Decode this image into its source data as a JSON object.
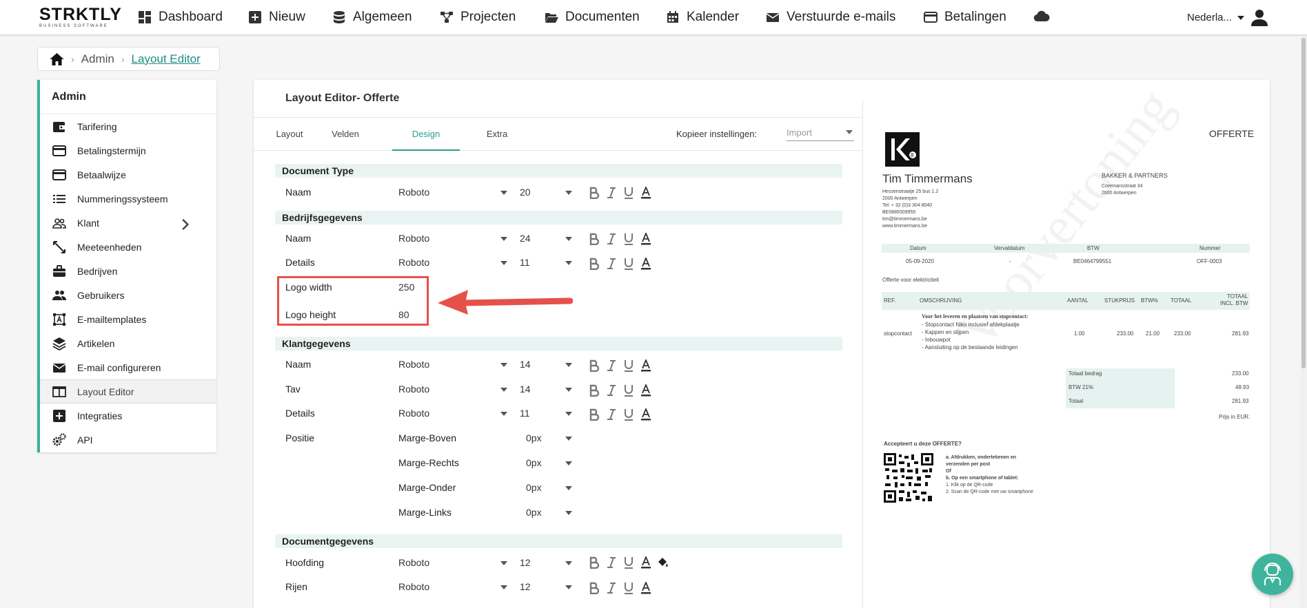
{
  "brand": {
    "name": "STRKTLY",
    "tagline": "BUSINESS SOFTWARE"
  },
  "nav": {
    "items": [
      {
        "label": "Dashboard",
        "icon": "dashboard-icon"
      },
      {
        "label": "Nieuw",
        "icon": "plus-square-icon"
      },
      {
        "label": "Algemeen",
        "icon": "database-icon"
      },
      {
        "label": "Projecten",
        "icon": "sitemap-icon"
      },
      {
        "label": "Documenten",
        "icon": "folder-open-icon"
      },
      {
        "label": "Kalender",
        "icon": "calendar-icon"
      },
      {
        "label": "Verstuurde e-mails",
        "icon": "envelope-icon"
      },
      {
        "label": "Betalingen",
        "icon": "credit-card-icon"
      }
    ],
    "cloud_icon": "cloud-icon",
    "language": "Nederla...",
    "user_icon": "user-icon"
  },
  "breadcrumb": {
    "home_icon": "home-icon",
    "admin": "Admin",
    "current": "Layout Editor"
  },
  "sidebar": {
    "title": "Admin",
    "items": [
      {
        "label": "Tarifering",
        "icon": "wallet-icon"
      },
      {
        "label": "Betalingstermijn",
        "icon": "credit-card-icon"
      },
      {
        "label": "Betaalwijze",
        "icon": "credit-card-icon"
      },
      {
        "label": "Nummeringssysteem",
        "icon": "list-icon"
      },
      {
        "label": "Klant",
        "icon": "users-icon"
      },
      {
        "label": "Meeteenheden",
        "icon": "ruler-icon"
      },
      {
        "label": "Bedrijven",
        "icon": "briefcase-icon"
      },
      {
        "label": "Gebruikers",
        "icon": "people-icon"
      },
      {
        "label": "E-mailtemplates",
        "icon": "template-icon"
      },
      {
        "label": "Artikelen",
        "icon": "layers-icon"
      },
      {
        "label": "E-mail configureren",
        "icon": "envelope-icon"
      },
      {
        "label": "Layout Editor",
        "icon": "layout-icon"
      },
      {
        "label": "Integraties",
        "icon": "plus-square-icon"
      },
      {
        "label": "API",
        "icon": "gears-icon"
      }
    ],
    "active": "Layout Editor"
  },
  "editor": {
    "title": "Layout Editor- Offerte",
    "tabs": [
      "Layout",
      "Velden",
      "Design",
      "Extra"
    ],
    "active_tab": "Design",
    "copy_label": "Kopieer instellingen:",
    "copy_placeholder": "Import",
    "sections": {
      "document_type": {
        "title": "Document Type",
        "rows": [
          {
            "label": "Naam",
            "font": "Roboto",
            "size": "20"
          }
        ]
      },
      "bedrijf": {
        "title": "Bedrijfsgegevens",
        "rows": [
          {
            "label": "Naam",
            "font": "Roboto",
            "size": "24"
          },
          {
            "label": "Details",
            "font": "Roboto",
            "size": "11"
          }
        ],
        "logo_width_label": "Logo width",
        "logo_width": "250",
        "logo_height_label": "Logo height",
        "logo_height": "80"
      },
      "klant": {
        "title": "Klantgegevens",
        "rows": [
          {
            "label": "Naam",
            "font": "Roboto",
            "size": "14"
          },
          {
            "label": "Tav",
            "font": "Roboto",
            "size": "14"
          },
          {
            "label": "Details",
            "font": "Roboto",
            "size": "11"
          }
        ],
        "positie_label": "Positie",
        "margins": [
          {
            "label": "Marge-Boven",
            "value": "0px"
          },
          {
            "label": "Marge-Rechts",
            "value": "0px"
          },
          {
            "label": "Marge-Onder",
            "value": "0px"
          },
          {
            "label": "Marge-Links",
            "value": "0px"
          }
        ]
      },
      "document": {
        "title": "Documentgegevens",
        "rows": [
          {
            "label": "Hoofding",
            "font": "Roboto",
            "size": "12"
          },
          {
            "label": "Rijen",
            "font": "Roboto",
            "size": "12"
          }
        ]
      }
    }
  },
  "preview": {
    "doc_type": "OFFERTE",
    "company_name": "Tim Timmermans",
    "company_lines": [
      "Hessenstraatje 25 bus 1.2",
      "2000 Antwerpen",
      "Tel: + 32 (0)3 304 8040",
      "BE0889309955",
      "tim@timmermans.be",
      "www.timmermans.be"
    ],
    "client_name": "BAKKER & PARTNERS",
    "client_lines": [
      "Coremansstraat 34",
      "2600 Antwerpen"
    ],
    "meta_headers": [
      "Datum",
      "Vervaldatum",
      "BTW",
      "Nummer"
    ],
    "meta_values": [
      "05-09-2020",
      "-",
      "BE0464799551",
      "OFF-0003"
    ],
    "subject": "Offerte voor elektriciteit",
    "table_headers": [
      "REF.",
      "OMSCHRIJVING",
      "AANTAL",
      "STUKPRIJS",
      "BTW%",
      "TOTAAL",
      "TOTAAL",
      "INCL. BTW"
    ],
    "item": {
      "ref": "stopcontact",
      "title": "Voor het leveren en plaatsen van stopcontact:",
      "lines": [
        "- Stopcontact Niko inclusief afdekplaatje",
        "- Kappen en slijpen",
        "- Inbouwpot",
        "- Aansluiting op de bestaande leidingen"
      ],
      "aantal": "1.00",
      "stukprijs": "233.00",
      "btw": "21.00",
      "totaal": "233.00",
      "incl": "281.93"
    },
    "totals": [
      {
        "label": "Totaal bedrag",
        "value": "233.00"
      },
      {
        "label": "BTW 21%",
        "value": "48.93"
      },
      {
        "label": "Totaal",
        "value": "281.93"
      }
    ],
    "currency_note": "Prijs in EUR.",
    "accept_title": "Accepteert u deze OFFERTE?",
    "accept_lines": [
      "a. Afdrukken, ondertekenen en",
      "verzenden per post",
      "Of",
      "b. Op een smartphone of tablet:",
      "1. Klik op de QR-code",
      "2. Scan de QR-code met uw smartphone"
    ],
    "watermark": "Voorvertoning"
  },
  "help_icon": "support-agent-icon",
  "colors": {
    "accent": "#2a9d8f",
    "sidebar_border": "#3bb09f",
    "highlight": "#e5514a",
    "section_bg": "#e9f4f2"
  }
}
